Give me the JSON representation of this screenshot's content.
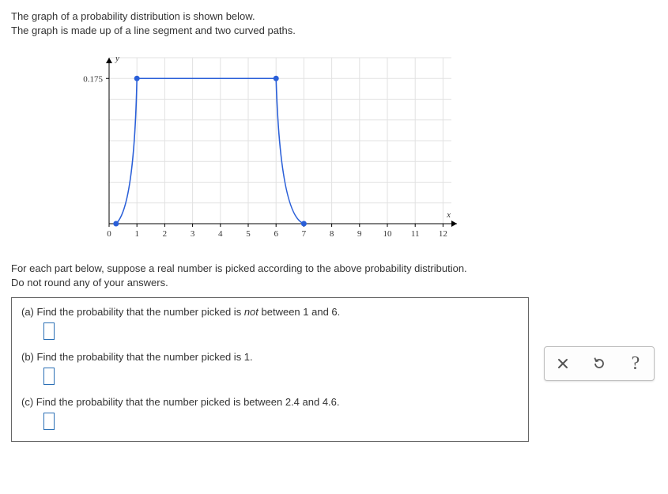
{
  "prompt": {
    "line1": "The graph of a probability distribution is shown below.",
    "line2": "The graph is made up of a line segment and two curved paths."
  },
  "chart_data": {
    "type": "line",
    "title": "",
    "xlabel": "x",
    "ylabel": "y",
    "xlim": [
      0,
      12.5
    ],
    "ylim": [
      0,
      0.2
    ],
    "xticks": [
      0,
      1,
      2,
      3,
      4,
      5,
      6,
      7,
      8,
      9,
      10,
      11,
      12
    ],
    "yticks": [
      0.175
    ],
    "segments": [
      {
        "kind": "curve",
        "from": {
          "x": 0.25,
          "y": 0
        },
        "to": {
          "x": 1,
          "y": 0.175
        },
        "control": {
          "x": 0.9,
          "y": 0.02
        }
      },
      {
        "kind": "line",
        "from": {
          "x": 1,
          "y": 0.175
        },
        "to": {
          "x": 6,
          "y": 0.175
        }
      },
      {
        "kind": "curve",
        "from": {
          "x": 6,
          "y": 0.175
        },
        "to": {
          "x": 7,
          "y": 0
        },
        "control": {
          "x": 6.15,
          "y": 0.01
        }
      }
    ],
    "points": [
      {
        "x": 0.25,
        "y": 0
      },
      {
        "x": 1,
        "y": 0.175
      },
      {
        "x": 6,
        "y": 0.175
      },
      {
        "x": 7,
        "y": 0
      }
    ]
  },
  "questions_intro": {
    "line1": "For each part below, suppose a real number is picked according to the above probability distribution.",
    "line2": "Do not round any of your answers."
  },
  "parts": {
    "a": {
      "label_prefix": "(a) Find the probability that the number picked is ",
      "emph": "not",
      "label_suffix": " between 1 and 6."
    },
    "b": {
      "label": "(b) Find the probability that the number picked is 1."
    },
    "c": {
      "label": "(c) Find the probability that the number picked is between 2.4 and 4.6."
    }
  },
  "toolbox": {
    "close": "×",
    "reset": "↻",
    "help": "?"
  }
}
